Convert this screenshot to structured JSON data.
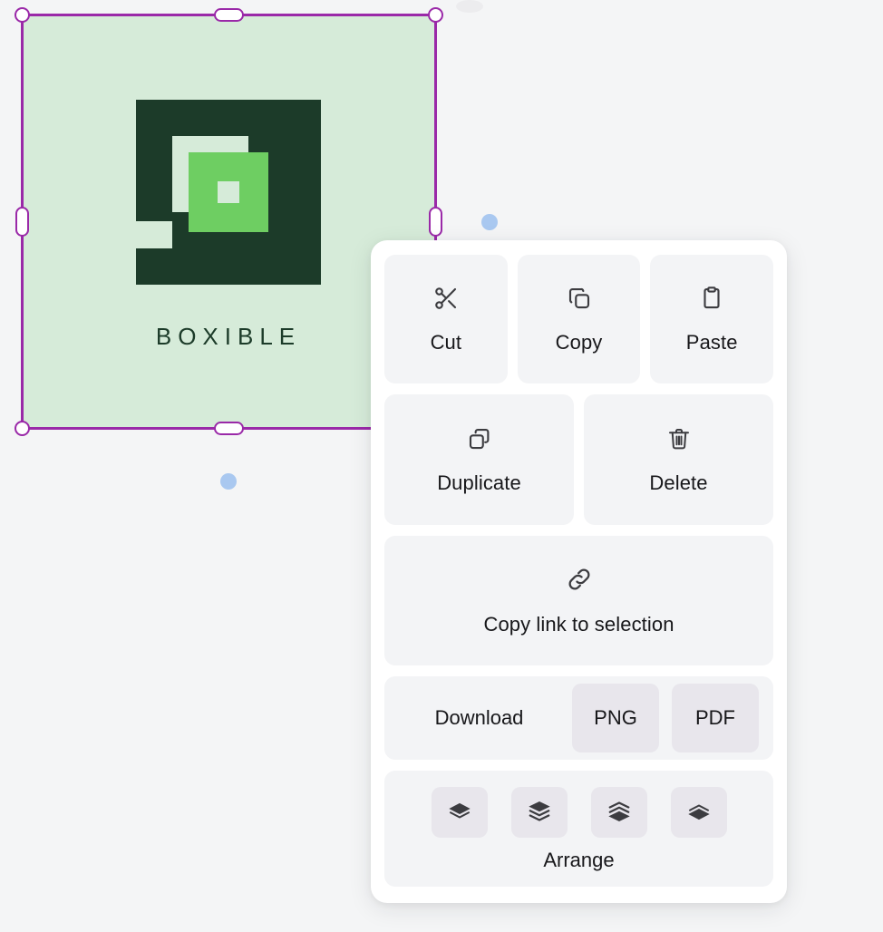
{
  "canvas": {
    "background_color": "#f4f5f6",
    "shape": {
      "name": "boxible-logo-card",
      "fill_color": "#d6ebd9",
      "brand_text": "BOXIBLE",
      "logo_dark_color": "#1c3b29",
      "logo_accent_color": "#6ece62",
      "logo_hole_color": "#d6ebd9"
    },
    "selection": {
      "stroke_color": "#9a29a8",
      "handle_fill": "#ffffff",
      "handle_names": [
        "handle-top-left",
        "handle-top-center",
        "handle-top-right",
        "handle-middle-left",
        "handle-middle-right",
        "handle-bottom-left",
        "handle-bottom-center",
        "handle-bottom-right"
      ]
    },
    "presence": {
      "dot_color": "#a9c8f0",
      "count": 2
    }
  },
  "context_menu": {
    "background_color": "#ffffff",
    "tile_color": "#f3f4f6",
    "accent_tile_color": "#e8e6ec",
    "clipboard_row": [
      {
        "id": "cut",
        "label": "Cut",
        "icon": "scissors-icon"
      },
      {
        "id": "copy",
        "label": "Copy",
        "icon": "copy-icon"
      },
      {
        "id": "paste",
        "label": "Paste",
        "icon": "clipboard-icon"
      }
    ],
    "object_row": [
      {
        "id": "duplicate",
        "label": "Duplicate",
        "icon": "duplicate-icon"
      },
      {
        "id": "delete",
        "label": "Delete",
        "icon": "trash-icon"
      }
    ],
    "link_action": {
      "id": "copy-link",
      "label": "Copy link to selection",
      "icon": "link-icon"
    },
    "download": {
      "label": "Download",
      "formats": [
        {
          "id": "png",
          "label": "PNG"
        },
        {
          "id": "pdf",
          "label": "PDF"
        }
      ]
    },
    "arrange": {
      "label": "Arrange",
      "buttons": [
        {
          "id": "bring-forward",
          "icon": "bring-forward-icon"
        },
        {
          "id": "bring-to-front",
          "icon": "bring-to-front-icon"
        },
        {
          "id": "send-to-back",
          "icon": "send-to-back-icon"
        },
        {
          "id": "send-backward",
          "icon": "send-backward-icon"
        }
      ]
    }
  }
}
